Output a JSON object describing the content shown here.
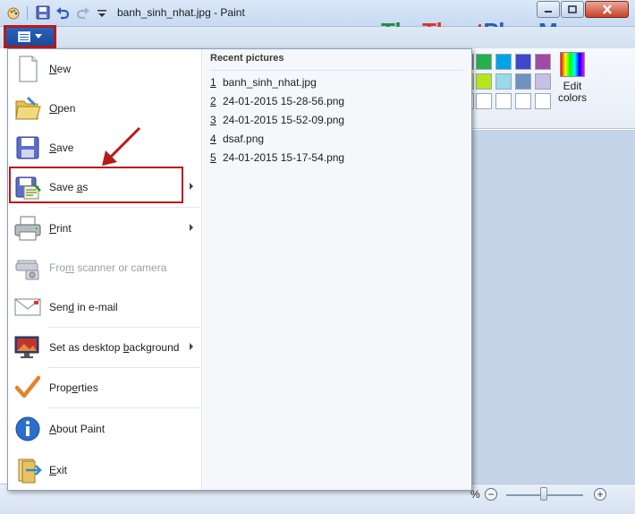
{
  "window": {
    "title": "banh_sinh_nhat.jpg - Paint"
  },
  "watermark": {
    "part_a": "Thu",
    "part_b": "Thuat",
    "part_c": "PhanMem.vn"
  },
  "quick_access": [
    "paint-app-icon",
    "save-icon",
    "undo-icon",
    "redo-icon",
    "customize-dropdown-icon"
  ],
  "ribbon": {
    "edit_colors_line1": "Edit",
    "edit_colors_line2": "colors",
    "swatches": [
      [
        "#22b14c",
        "#00a2e8",
        "#3f48cc",
        "#a349a4"
      ],
      [
        "#b5e61d",
        "#99d9ea",
        "#7092be",
        "#c8bfe7"
      ],
      [
        "#ffffff",
        "#ffffff",
        "#ffffff",
        "#ffffff"
      ]
    ],
    "partial_swatches": [
      "#7f7f7f",
      "#b5e61d",
      "#ffffff"
    ]
  },
  "status": {
    "zoom_suffix": "%",
    "zoom_out": "−",
    "zoom_in": "+"
  },
  "menu": {
    "items": [
      {
        "label": "New",
        "mnemonic": "N",
        "rest": "ew",
        "icon": "new-file-icon",
        "submenu": false
      },
      {
        "label": "Open",
        "mnemonic": "O",
        "rest": "pen",
        "icon": "open-folder-icon",
        "submenu": false
      },
      {
        "label": "Save",
        "mnemonic": "S",
        "rest": "ave",
        "icon": "save-disk-icon",
        "submenu": false
      },
      {
        "label": "Save as",
        "pre": "Save ",
        "mnemonic": "a",
        "rest": "s",
        "icon": "save-as-icon",
        "submenu": true
      },
      {
        "label": "Print",
        "mnemonic": "P",
        "rest": "rint",
        "icon": "printer-icon",
        "submenu": true
      },
      {
        "label": "From scanner or camera",
        "pre": "Fro",
        "mnemonic": "m",
        "rest": " scanner or camera",
        "icon": "scanner-camera-icon",
        "submenu": false,
        "disabled": true
      },
      {
        "label": "Send in e-mail",
        "pre": "Sen",
        "mnemonic": "d",
        "rest": " in e-mail",
        "icon": "email-icon",
        "submenu": false
      },
      {
        "label": "Set as desktop background",
        "pre": "Set as desktop ",
        "mnemonic": "b",
        "rest": "ackground",
        "icon": "desktop-background-icon",
        "submenu": true
      },
      {
        "label": "Properties",
        "pre": "Prop",
        "mnemonic": "e",
        "rest": "rties",
        "icon": "checkmark-properties-icon",
        "submenu": false
      },
      {
        "label": "About Paint",
        "pre": "",
        "mnemonic": "A",
        "rest": "bout Paint",
        "icon": "info-icon",
        "submenu": false
      },
      {
        "label": "Exit",
        "pre": "",
        "mnemonic": "E",
        "rest": "xit",
        "icon": "exit-icon",
        "submenu": false
      }
    ],
    "recent_title": "Recent pictures",
    "recent": [
      {
        "num": "1",
        "name": "banh_sinh_nhat.jpg"
      },
      {
        "num": "2",
        "name": "24-01-2015 15-28-56.png"
      },
      {
        "num": "3",
        "name": "24-01-2015 15-52-09.png"
      },
      {
        "num": "4",
        "name": "dsaf.png"
      },
      {
        "num": "5",
        "name": "24-01-2015 15-17-54.png"
      }
    ]
  },
  "colors": {
    "highlight_box": "#b81a1a",
    "arrow": "#b81a1a",
    "app_button": "#1b4a98"
  }
}
